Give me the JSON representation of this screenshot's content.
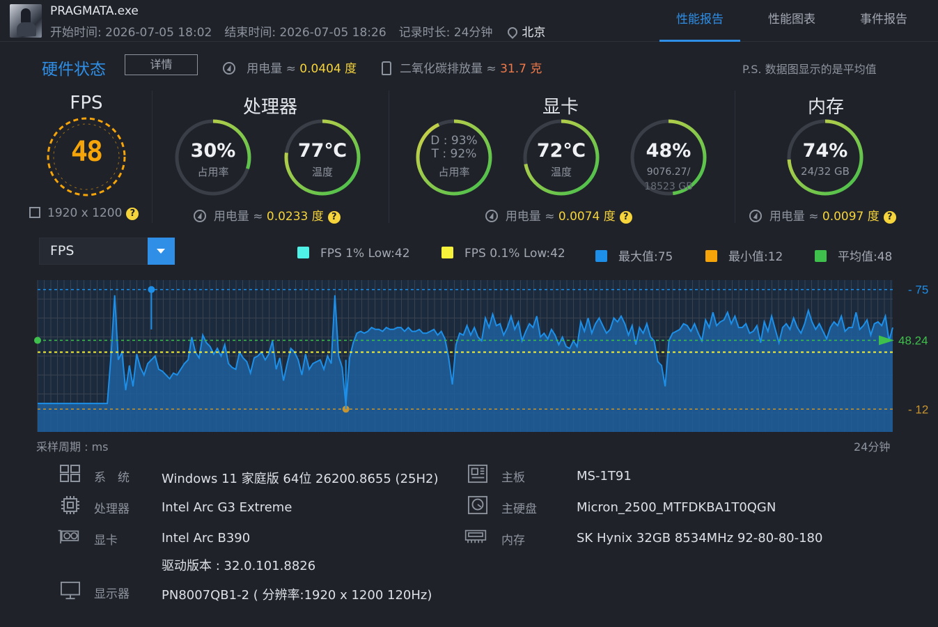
{
  "header": {
    "app_name": "PRAGMATA.exe",
    "start_time": "开始时间: 2026-07-05 18:02",
    "end_time": "结束时间: 2026-07-05 18:26",
    "duration": "记录时长: 24分钟",
    "location": "北京",
    "tabs": [
      {
        "label": "性能报告",
        "active": true
      },
      {
        "label": "性能图表",
        "active": false
      },
      {
        "label": "事件报告",
        "active": false
      }
    ]
  },
  "hardware": {
    "title": "硬件状态",
    "detail_button": "详情",
    "power_label": "用电量 ≈ ",
    "power_value": "0.0404 度",
    "co2_label": "二氧化碳排放量 ≈ ",
    "co2_value": "31.7 克",
    "note": "P.S. 数据图显示的是平均值"
  },
  "sections": {
    "fps": {
      "title": "FPS",
      "value": "48",
      "fill": 1.0,
      "resolution": "1920 x 1200"
    },
    "cpu": {
      "title": "处理器",
      "usage": {
        "value": "30%",
        "label": "占用率",
        "fill": 0.3
      },
      "temp": {
        "value": "77℃",
        "label": "温度",
        "fill": 0.77
      },
      "power_label": "用电量 ≈ ",
      "power_value": "0.0233 度"
    },
    "gpu": {
      "title": "显卡",
      "usage": {
        "line1": "D : 93%",
        "line2": "T : 92%",
        "label": "占用率",
        "fill": 0.93
      },
      "temp": {
        "value": "72℃",
        "label": "温度",
        "fill": 0.72
      },
      "vram": {
        "value": "48%",
        "line1": "9076.27/",
        "line2": "18523 GB",
        "fill": 0.48
      },
      "power_label": "用电量 ≈ ",
      "power_value": "0.0074 度"
    },
    "mem": {
      "title": "内存",
      "usage": {
        "value": "74%",
        "label": "24/32 GB",
        "fill": 0.74
      },
      "power_label": "用电量 ≈ ",
      "power_value": "0.0097 度"
    }
  },
  "chart_header": {
    "metric": "FPS",
    "legend": [
      {
        "label": "FPS 1% Low:42",
        "color": "#4ff0e6"
      },
      {
        "label": "FPS 0.1% Low:42",
        "color": "#f6f23c"
      },
      {
        "label": "最大值:75",
        "color": "#1d8fe8"
      },
      {
        "label": "最小值:12",
        "color": "#f5a40a"
      },
      {
        "label": "平均值:48",
        "color": "#3fbf4c"
      }
    ],
    "period_label": "采样周期 : ms",
    "duration_label": "24分钟"
  },
  "chart_data": {
    "type": "area",
    "ylim": [
      0,
      80
    ],
    "max": 75,
    "min": 12,
    "avg": 48.24,
    "low1": 42,
    "max_label": "75",
    "min_label": "12",
    "avg_label": "48.24",
    "values": [
      15,
      15,
      15,
      15,
      15,
      15,
      15,
      15,
      15,
      15,
      15,
      15,
      15,
      15,
      15,
      15,
      15,
      15,
      15,
      15,
      40,
      72,
      38,
      42,
      22,
      35,
      24,
      41,
      34,
      30,
      36,
      38,
      40,
      33,
      32,
      30,
      28,
      31,
      30,
      33,
      36,
      38,
      50,
      42,
      39,
      51,
      47,
      45,
      41,
      44,
      40,
      46,
      36,
      34,
      33,
      42,
      39,
      37,
      31,
      39,
      40,
      42,
      38,
      41,
      48,
      33,
      39,
      27,
      36,
      44,
      42,
      38,
      30,
      41,
      33,
      36,
      37,
      38,
      33,
      40,
      36,
      72,
      40,
      34,
      14,
      39,
      47,
      52,
      53,
      52,
      53,
      55,
      54,
      54,
      53,
      55,
      54,
      54,
      55,
      55,
      53,
      55,
      53,
      53,
      54,
      52,
      52,
      53,
      54,
      51,
      53,
      49,
      39,
      25,
      46,
      52,
      51,
      56,
      51,
      55,
      50,
      48,
      60,
      55,
      62,
      56,
      57,
      51,
      55,
      61,
      54,
      58,
      48,
      53,
      57,
      55,
      61,
      50,
      52,
      49,
      54,
      51,
      46,
      50,
      45,
      44,
      48,
      45,
      58,
      53,
      60,
      52,
      57,
      60,
      56,
      52,
      54,
      60,
      58,
      61,
      57,
      51,
      56,
      46,
      55,
      52,
      57,
      50,
      48,
      37,
      35,
      24,
      48,
      52,
      53,
      54,
      57,
      56,
      53,
      57,
      52,
      48,
      59,
      55,
      63,
      56,
      58,
      59,
      63,
      57,
      61,
      55,
      55,
      57,
      52,
      53,
      56,
      47,
      58,
      53,
      61,
      54,
      47,
      55,
      57,
      54,
      60,
      55,
      52,
      57,
      64,
      58,
      54,
      57,
      53,
      49,
      55,
      58,
      56,
      61,
      53,
      55,
      55,
      63,
      54,
      56,
      59,
      51,
      57,
      58,
      56,
      61,
      48,
      55
    ]
  },
  "specs": {
    "os": {
      "label": "系　统",
      "value": "Windows 11 家庭版 64位 26200.8655 (25H2)"
    },
    "cpu": {
      "label": "处理器",
      "value": "Intel Arc G3 Extreme"
    },
    "gpu": {
      "label": "显卡",
      "value": "Intel Arc B390",
      "driver": "驱动版本 : 32.0.101.8826"
    },
    "monitor": {
      "label": "显示器",
      "value": "PN8007QB1-2 ( 分辨率:1920 x 1200 120Hz)"
    },
    "board": {
      "label": "主板",
      "value": "MS-1T91"
    },
    "disk": {
      "label": "主硬盘",
      "value": "Micron_2500_MTFDKBA1T0QGN"
    },
    "ram": {
      "label": "内存",
      "value": "SK Hynix 32GB 8534MHz 92-80-80-180"
    }
  }
}
